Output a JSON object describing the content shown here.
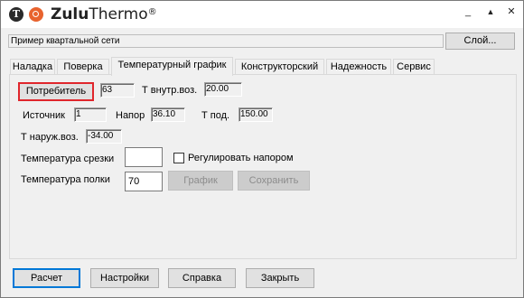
{
  "window": {
    "brand_bold": "Zulu",
    "brand_light": "Thermo",
    "brand_mark": "®",
    "logo_letter": "T"
  },
  "controls": {
    "minimize": "_",
    "maximize": "▲",
    "close": "✕"
  },
  "network": {
    "name": "Пример квартальной сети",
    "layer_button": "Слой..."
  },
  "tabs": [
    {
      "label": "Наладка"
    },
    {
      "label": "Поверка"
    },
    {
      "label": "Температурный график",
      "active": true
    },
    {
      "label": "Конструкторский"
    },
    {
      "label": "Надежность"
    },
    {
      "label": "Сервис"
    }
  ],
  "form": {
    "consumer_button": "Потребитель",
    "consumer_value": "63",
    "t_inner_label": "Т внутр.воз.",
    "t_inner_value": "20.00",
    "source_label": "Источник",
    "source_value": "1",
    "head_label": "Напор",
    "head_value": "36.10",
    "t_under_label": "Т под.",
    "t_under_value": "150.00",
    "t_outer_label": "Т наруж.воз.",
    "t_outer_value": "-34.00",
    "cutoff_label": "Температура срезки",
    "cutoff_value": "",
    "regulate_label": "Регулировать напором",
    "regulate_checked": false,
    "shelf_label": "Температура полки",
    "shelf_value": "70",
    "graph_button": "График",
    "save_button": "Сохранить"
  },
  "footer": {
    "calc": "Расчет",
    "settings": "Настройки",
    "help": "Справка",
    "close": "Закрыть"
  }
}
